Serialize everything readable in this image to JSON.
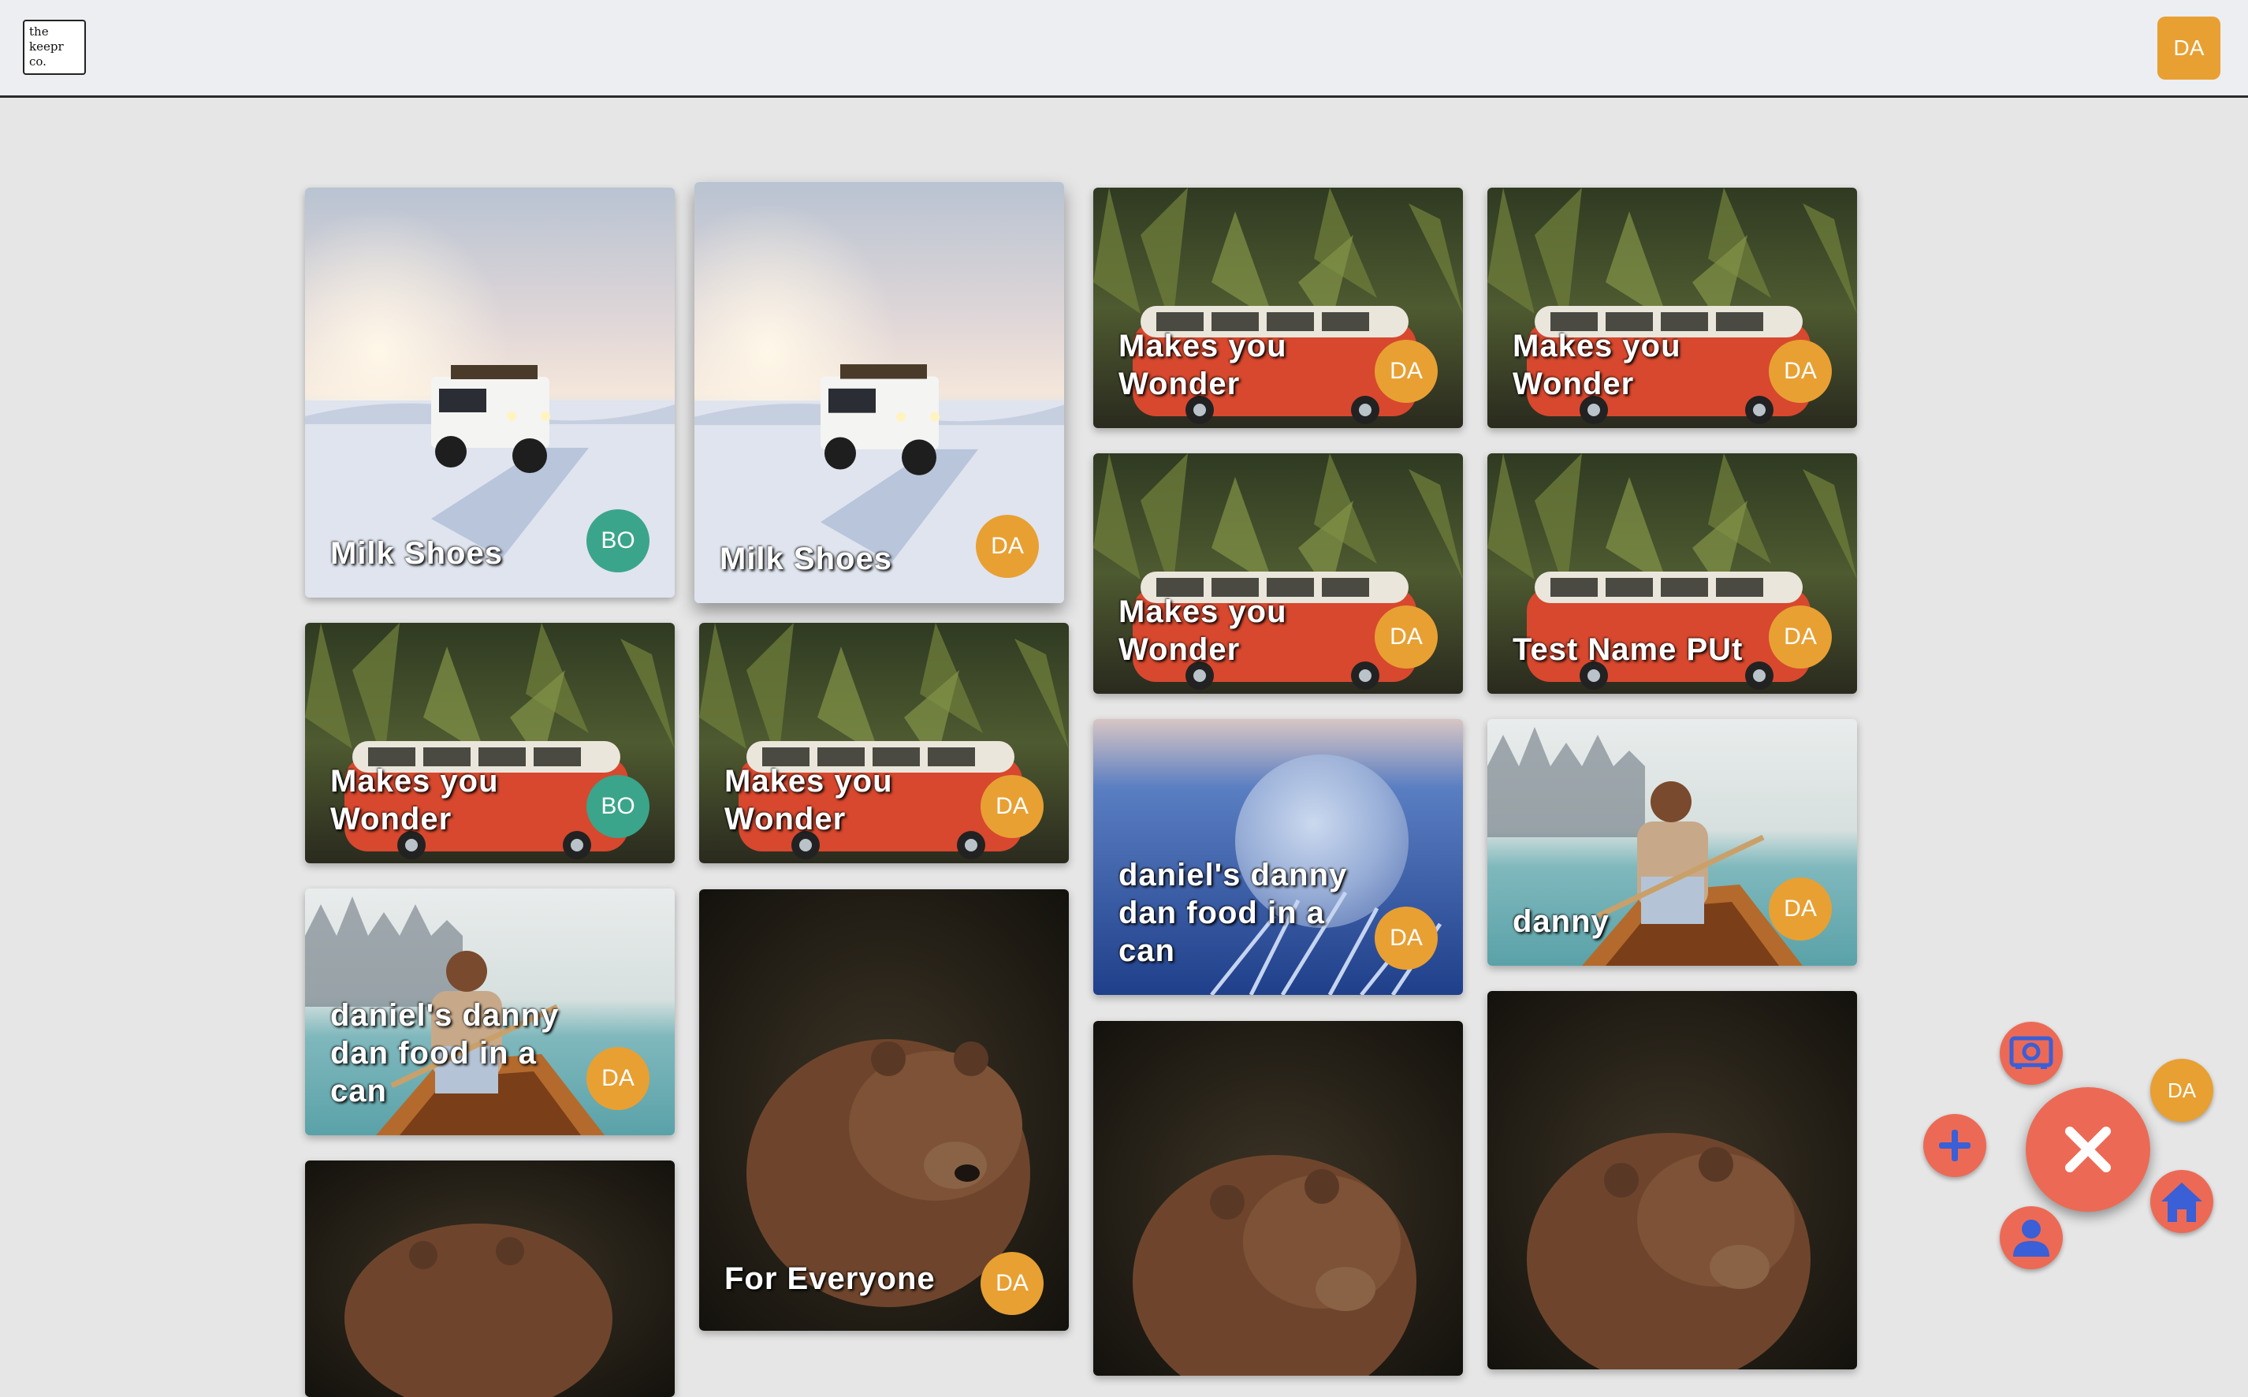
{
  "header": {
    "logo_lines": [
      "the",
      "keepr",
      "co."
    ],
    "user_initials": "DA"
  },
  "keeps": [
    {
      "title": "Milk Shoes",
      "creator": "BO",
      "image": "snow-jeep",
      "badge_color": "#3aa58a"
    },
    {
      "title": "Milk Shoes",
      "creator": "DA",
      "image": "snow-jeep",
      "badge_color": "#e8a033"
    },
    {
      "title": "Makes you Wonder",
      "creator": "DA",
      "image": "van-jungle",
      "badge_color": "#e8a033"
    },
    {
      "title": "Makes you Wonder",
      "creator": "DA",
      "image": "van-jungle",
      "badge_color": "#e8a033"
    },
    {
      "title": "Makes you Wonder",
      "creator": "DA",
      "image": "van-jungle",
      "badge_color": "#e8a033"
    },
    {
      "title": "Test Name PUt",
      "creator": "DA",
      "image": "van-jungle",
      "badge_color": "#e8a033"
    },
    {
      "title": "Makes you Wonder",
      "creator": "BO",
      "image": "van-jungle",
      "badge_color": "#3aa58a"
    },
    {
      "title": "Makes you Wonder",
      "creator": "DA",
      "image": "van-jungle",
      "badge_color": "#e8a033"
    },
    {
      "title": "daniel's danny dan food in a can",
      "creator": "DA",
      "image": "frozen-bubble",
      "badge_color": "#e8a033"
    },
    {
      "title": "danny",
      "creator": "DA",
      "image": "lake-boat",
      "badge_color": "#e8a033"
    },
    {
      "title": "daniel's danny dan food in a can",
      "creator": "DA",
      "image": "lake-boat",
      "badge_color": "#e8a033"
    },
    {
      "title": "For Everyone",
      "creator": "DA",
      "image": "brown-bear",
      "badge_color": "#e8a033"
    },
    {
      "title": "",
      "creator": "",
      "image": "brown-bear",
      "badge_color": "#e8a033"
    },
    {
      "title": "",
      "creator": "",
      "image": "brown-bear",
      "badge_color": "#e8a033"
    },
    {
      "title": "",
      "creator": "",
      "image": "brown-bear",
      "badge_color": "#e8a033"
    }
  ],
  "fab_menu": {
    "close_icon": "close-icon",
    "add_icon": "plus-icon",
    "vault_icon": "vault-icon",
    "profile_icon": "user-icon",
    "home_icon": "home-icon",
    "user_initials": "DA"
  }
}
